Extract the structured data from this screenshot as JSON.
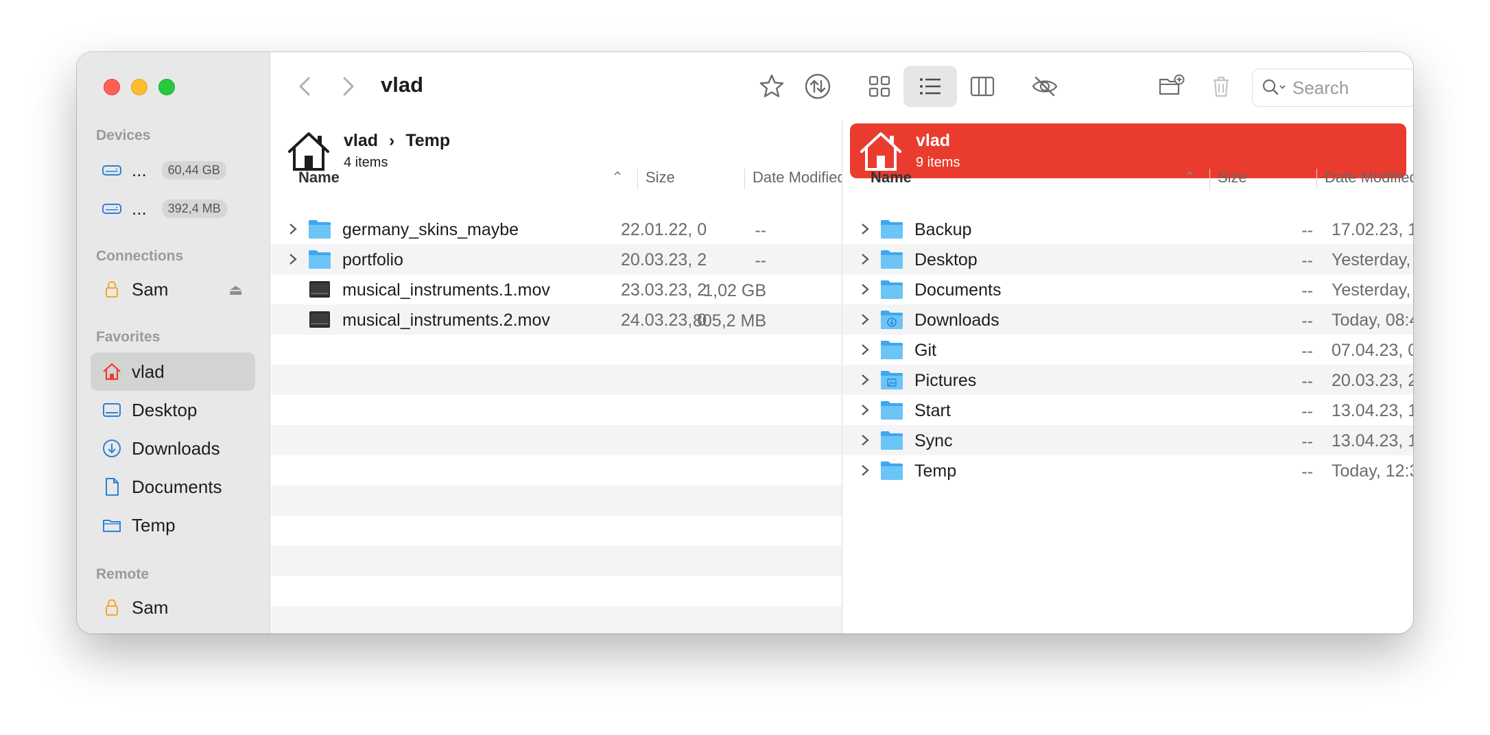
{
  "window_title": "vlad",
  "sidebar": {
    "devices_label": "Devices",
    "devices": [
      {
        "label": "...",
        "size": "60,44 GB"
      },
      {
        "label": "...",
        "size": "392,4 MB"
      }
    ],
    "connections_label": "Connections",
    "connections": [
      {
        "label": "Sam"
      }
    ],
    "favorites_label": "Favorites",
    "favorites": [
      {
        "label": "vlad",
        "icon": "home-icon",
        "active": true
      },
      {
        "label": "Desktop",
        "icon": "desktop-icon"
      },
      {
        "label": "Downloads",
        "icon": "download-icon"
      },
      {
        "label": "Documents",
        "icon": "document-icon"
      },
      {
        "label": "Temp",
        "icon": "folder-icon"
      }
    ],
    "remote_label": "Remote",
    "remote": [
      {
        "label": "Sam"
      }
    ]
  },
  "toolbar": {
    "title": "vlad",
    "search_placeholder": "Search"
  },
  "left_pane": {
    "path_root": "vlad",
    "path_child": "Temp",
    "item_count": "4 items",
    "columns": {
      "name": "Name",
      "size": "Size",
      "date": "Date Modified"
    },
    "rows": [
      {
        "name": "germany_skins_maybe",
        "size": "--",
        "date": "22.01.22, 0",
        "type": "folder",
        "expandable": true
      },
      {
        "name": "portfolio",
        "size": "--",
        "date": "20.03.23, 2",
        "type": "folder",
        "expandable": true
      },
      {
        "name": "musical_instruments.1.mov",
        "size": "1,02 GB",
        "date": "23.03.23, 2",
        "type": "video",
        "expandable": false
      },
      {
        "name": "musical_instruments.2.mov",
        "size": "805,2 MB",
        "date": "24.03.23, 0",
        "type": "video",
        "expandable": false
      }
    ]
  },
  "right_pane": {
    "path_root": "vlad",
    "item_count": "9 items",
    "accent_color": "#ea3b2f",
    "columns": {
      "name": "Name",
      "size": "Size",
      "date": "Date Modified"
    },
    "rows": [
      {
        "name": "Backup",
        "size": "--",
        "date": "17.02.23, 1",
        "type": "folder"
      },
      {
        "name": "Desktop",
        "size": "--",
        "date": "Yesterday, ",
        "type": "folder"
      },
      {
        "name": "Documents",
        "size": "--",
        "date": "Yesterday, ",
        "type": "folder"
      },
      {
        "name": "Downloads",
        "size": "--",
        "date": "Today, 08:4",
        "type": "folder-download"
      },
      {
        "name": "Git",
        "size": "--",
        "date": "07.04.23, 0",
        "type": "folder"
      },
      {
        "name": "Pictures",
        "size": "--",
        "date": "20.03.23, 2",
        "type": "folder-pictures"
      },
      {
        "name": "Start",
        "size": "--",
        "date": "13.04.23, 1",
        "type": "folder"
      },
      {
        "name": "Sync",
        "size": "--",
        "date": "13.04.23, 1",
        "type": "folder"
      },
      {
        "name": "Temp",
        "size": "--",
        "date": "Today, 12:3",
        "type": "folder"
      }
    ]
  }
}
